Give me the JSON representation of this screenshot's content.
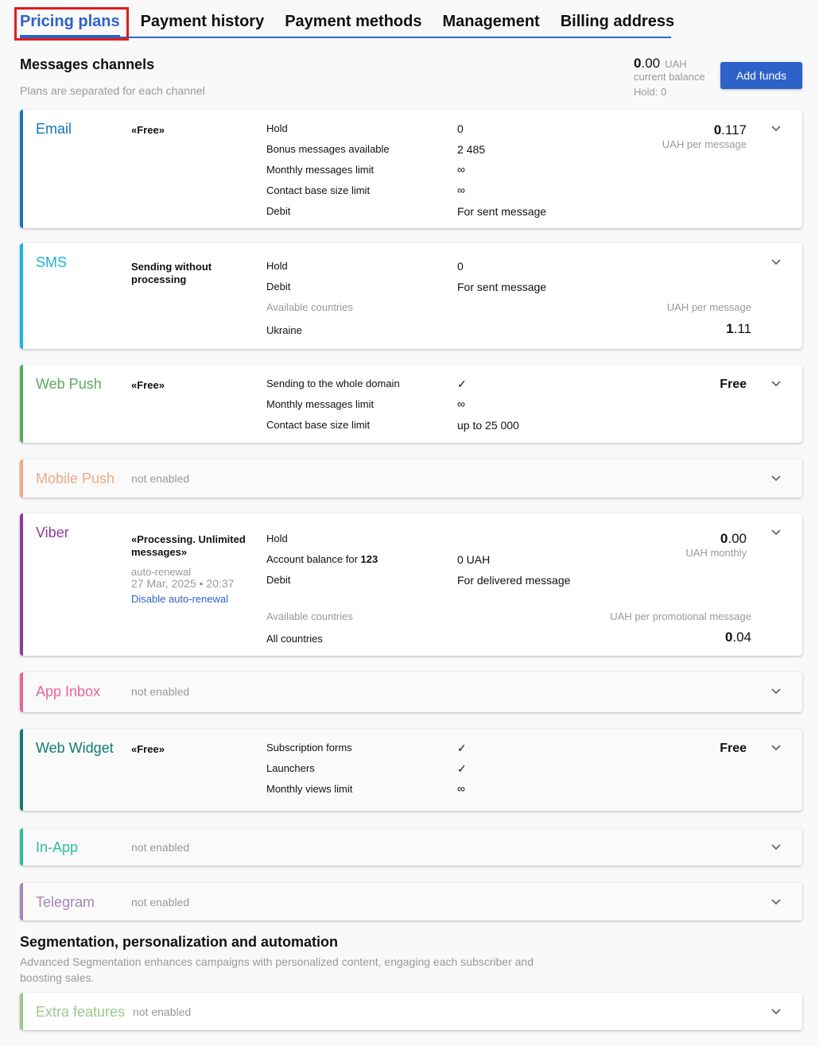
{
  "tabs": [
    {
      "label": "Pricing plans",
      "active": true
    },
    {
      "label": "Payment history",
      "active": false
    },
    {
      "label": "Payment methods",
      "active": false
    },
    {
      "label": "Management",
      "active": false
    },
    {
      "label": "Billing address",
      "active": false
    }
  ],
  "messages_section": {
    "title": "Messages channels",
    "subtitle": "Plans are separated for each channel"
  },
  "balance": {
    "amount_int": "0",
    "amount_dec": ".00",
    "currency": "UAH",
    "label": "current balance",
    "hold": "Hold: 0",
    "add_funds_label": "Add funds"
  },
  "colors": {
    "accent": "#2e62c8",
    "email": "#1577b3",
    "sms": "#1fb0e0",
    "web_push": "#5aaa5e",
    "mobile_push": "#f0a888",
    "viber": "#8e3a99",
    "app_inbox": "#e8639a",
    "web_widget": "#137a72",
    "in_app": "#2bbfa0",
    "telegram": "#a585b8",
    "extra_features": "#9cc98a"
  },
  "channels": {
    "email": {
      "name": "Email",
      "plan": "«Free»",
      "rows": [
        {
          "k": "Hold",
          "v": "0"
        },
        {
          "k": "Bonus messages available",
          "v": "2 485"
        },
        {
          "k": "Monthly messages limit",
          "v": "∞"
        },
        {
          "k": "Contact base size limit",
          "v": "∞"
        },
        {
          "k": "Debit",
          "v": "For sent message"
        }
      ],
      "price_int": "0",
      "price_dec": ".117",
      "price_unit": "UAH per message"
    },
    "sms": {
      "name": "SMS",
      "plan": "Sending without processing",
      "rows": [
        {
          "k": "Hold",
          "v": "0"
        },
        {
          "k": "Debit",
          "v": "For sent message"
        }
      ],
      "countries_label": "Available countries",
      "price_unit": "UAH per message",
      "country": "Ukraine",
      "price_int": "1",
      "price_dec": ".11"
    },
    "web_push": {
      "name": "Web Push",
      "plan": "«Free»",
      "rows": [
        {
          "k": "Sending to the whole domain",
          "v": "✓"
        },
        {
          "k": "Monthly messages limit",
          "v": "∞"
        },
        {
          "k": "Contact base size limit",
          "v": "up to 25 000"
        }
      ],
      "price": "Free"
    },
    "mobile_push": {
      "name": "Mobile Push",
      "status": "not enabled"
    },
    "viber": {
      "name": "Viber",
      "plan": "«Processing. Unlimited messages»",
      "renewal_label": "auto-renewal",
      "renewal_date": "27 Mar, 2025 • 20:37",
      "disable_link": "Disable auto-renewal",
      "rows": [
        {
          "k": "Hold",
          "v": ""
        },
        {
          "k": "Account balance for ",
          "k_bold": "123",
          "v": "0 UAH"
        },
        {
          "k": "Debit",
          "v": "For delivered message"
        }
      ],
      "price_int": "0",
      "price_dec": ".00",
      "price_unit": "UAH monthly",
      "countries_label": "Available countries",
      "promo_unit": "UAH per promotional message",
      "country": "All countries",
      "promo_int": "0",
      "promo_dec": ".04"
    },
    "app_inbox": {
      "name": "App Inbox",
      "status": "not enabled"
    },
    "web_widget": {
      "name": "Web Widget",
      "plan": "«Free»",
      "rows": [
        {
          "k": "Subscription forms",
          "v": "✓"
        },
        {
          "k": "Launchers",
          "v": "✓"
        },
        {
          "k": "Monthly views limit",
          "v": "∞"
        }
      ],
      "price": "Free"
    },
    "in_app": {
      "name": "In-App",
      "status": "not enabled"
    },
    "telegram": {
      "name": "Telegram",
      "status": "not enabled"
    }
  },
  "segmentation_section": {
    "title": "Segmentation, personalization and automation",
    "subtitle": "Advanced Segmentation enhances campaigns with personalized content, engaging each subscriber and boosting sales."
  },
  "extra_features": {
    "name": "Extra features",
    "status": "not enabled"
  }
}
